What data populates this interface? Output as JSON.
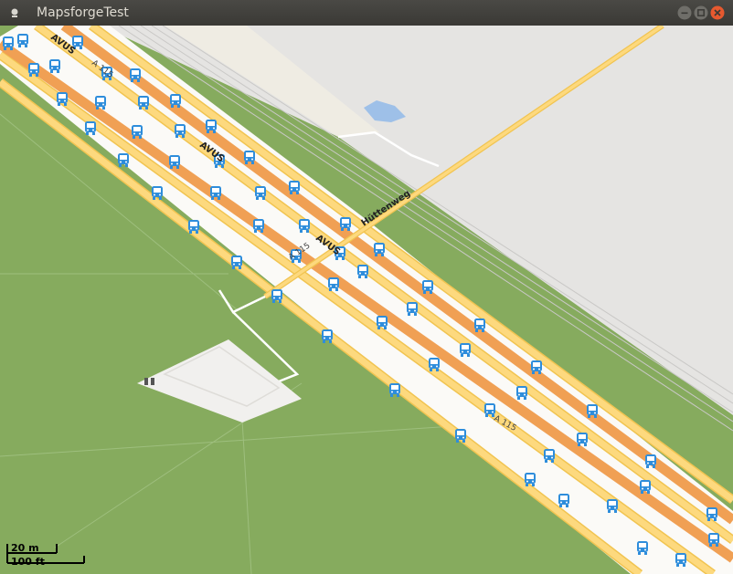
{
  "window": {
    "title": "MapsforgeTest",
    "controls": [
      "minimize",
      "maximize",
      "close"
    ]
  },
  "map": {
    "labels": {
      "road_primary": "AVUS",
      "street": "Hüttenweg",
      "ref": "A 115"
    },
    "scale": {
      "metric": "20 m",
      "imperial": "100 ft"
    },
    "poi_icon": "bus-stop-icon",
    "colors": {
      "forest": "#86ab5e",
      "road_casing": "#fbfaf7",
      "motorway": "#f5a95c",
      "trunk": "#fdd471",
      "rail_area": "#e3e2e2",
      "water": "#9ec0e8",
      "bus_icon": "#2e8ddb"
    }
  }
}
